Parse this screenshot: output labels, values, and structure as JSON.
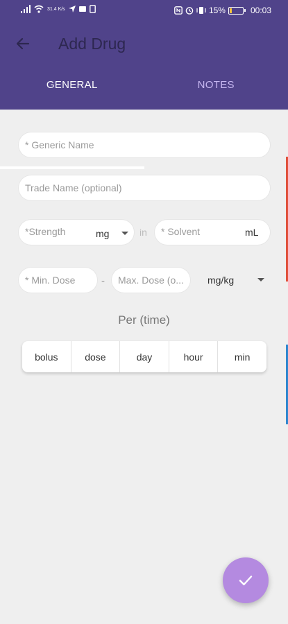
{
  "status_bar": {
    "net_speed": "31.4 K/s",
    "battery": "15%",
    "battery_level": 0.15,
    "time": "00:03"
  },
  "app_bar": {
    "title": "Add Drug",
    "back_icon": "arrow-left-icon"
  },
  "tabs": [
    {
      "label": "GENERAL",
      "active": true
    },
    {
      "label": "NOTES",
      "active": false
    }
  ],
  "form": {
    "generic_name": {
      "placeholder": "* Generic Name",
      "value": ""
    },
    "trade_name": {
      "placeholder": "Trade Name (optional)",
      "value": ""
    },
    "strength": {
      "placeholder": "*Strength",
      "unit": "mg"
    },
    "in_label": "in",
    "solvent": {
      "placeholder": "* Solvent",
      "unit": "mL"
    },
    "min_dose": {
      "placeholder": "* Min. Dose"
    },
    "dash": "-",
    "max_dose": {
      "placeholder": "Max. Dose (o..."
    },
    "dose_unit": "mg/kg"
  },
  "per_time": {
    "label": "Per (time)",
    "options": [
      "bolus",
      "dose",
      "day",
      "hour",
      "min"
    ]
  },
  "fab": {
    "icon": "check-icon"
  },
  "colors": {
    "primary": "#50438a",
    "accent": "#b48ae0",
    "background": "#efefef"
  }
}
